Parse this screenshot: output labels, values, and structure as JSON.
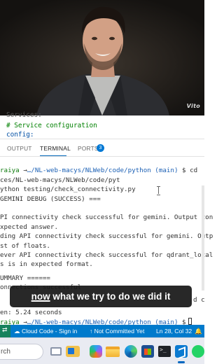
{
  "webcam": {
    "logo": "Vito"
  },
  "editor": {
    "lines": [
      "Services:",
      "# Service configuration",
      "config:"
    ]
  },
  "panel_tabs": {
    "output": "OUTPUT",
    "terminal": "TERMINAL",
    "ports": "PORTS",
    "ports_badge": "3"
  },
  "terminal": {
    "prompt1": {
      "user": "raiya",
      "sep": " →",
      "path": "…/NL-web-macys/NLWeb/code/python",
      "branch": " (main)",
      "cmd": " $ cd"
    },
    "lines": [
      "ces/NL-web-macys/NLWeb/code/pyt",
      "ython testing/check_connectivity.py",
      "GEMINI DEBUG (SUCCESS) ===",
      "",
      "PI connectivity check successful for gemini. Output con",
      "xpected answer.",
      "ding API connectivity check successful for gemini. Outp",
      "st of floats.",
      "ever API connectivity check successful for qdrant_local",
      "s is in expected format.",
      "",
      "UMMARY ======",
      "onnections successful",
      "",
      "en: 5.24 seconds"
    ],
    "prompt2": {
      "user": "raiya",
      "sep": " →",
      "path": "…/NL-web-macys/NLWeb/code/python",
      "branch": " (main)",
      "cmd": " $"
    },
    "partial_right": "d c"
  },
  "caption": {
    "emphasis": "now",
    "rest": " what we try to do we did it"
  },
  "statusbar": {
    "remote_icon": "⇄",
    "cloud_code": "☁ Cloud Code - Sign in",
    "git": "↑ Not Committed Yet",
    "position": "Ln 28, Col 32",
    "bell": "🔔",
    "colors": {
      "background": "#007acc",
      "remote": "#16825d"
    }
  },
  "taskbar": {
    "search_label": "rch",
    "icons": [
      "task-view-icon",
      "widgets-icon",
      "copilot-icon",
      "file-explorer-icon",
      "edge-icon",
      "store-icon",
      "terminal-icon",
      "vscode-icon",
      "whatsapp-icon"
    ]
  }
}
